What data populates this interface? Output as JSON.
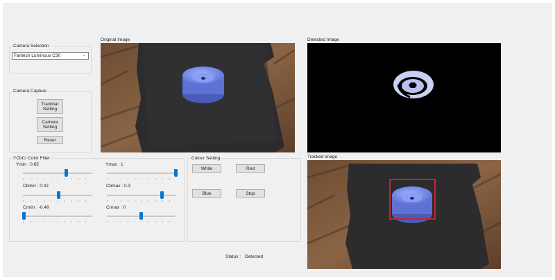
{
  "camera_selection": {
    "group_label": "Camera Selection",
    "selected_camera": "Fantech Luminous C30"
  },
  "camera_capture": {
    "group_label": "Camera Capture",
    "trackbar_setting_label": "Trackbar\nSetting",
    "camera_setting_label": "Camera\nSetting",
    "reset_label": "Reset"
  },
  "ycbcr_filter": {
    "group_label": "YCbCr Color Filter",
    "sliders": [
      {
        "label": "Ymin : 0.65",
        "position": 0.62
      },
      {
        "label": "Ymax : 1",
        "position": 1.0
      },
      {
        "label": "Cbmin : 0.02",
        "position": 0.51
      },
      {
        "label": "Cbmax : 0.3",
        "position": 0.8
      },
      {
        "label": "Crmin : -0.49",
        "position": 0.01
      },
      {
        "label": "Crmax : 0",
        "position": 0.5
      }
    ]
  },
  "colour_setting": {
    "group_label": "Colour Setting",
    "white_label": "White",
    "red_label": "Red",
    "blue_label": "Blue",
    "stop_label": "Stop"
  },
  "images": {
    "original_label": "Original Image",
    "detected_label": "Detected Image",
    "tracked_label": "Tracked Image"
  },
  "status": {
    "label": "Status :",
    "value": "Detected"
  },
  "colors": {
    "slider_thumb": "#0078d7",
    "tracking_box": "#d0202a",
    "object_blue": "#6f86e0"
  }
}
